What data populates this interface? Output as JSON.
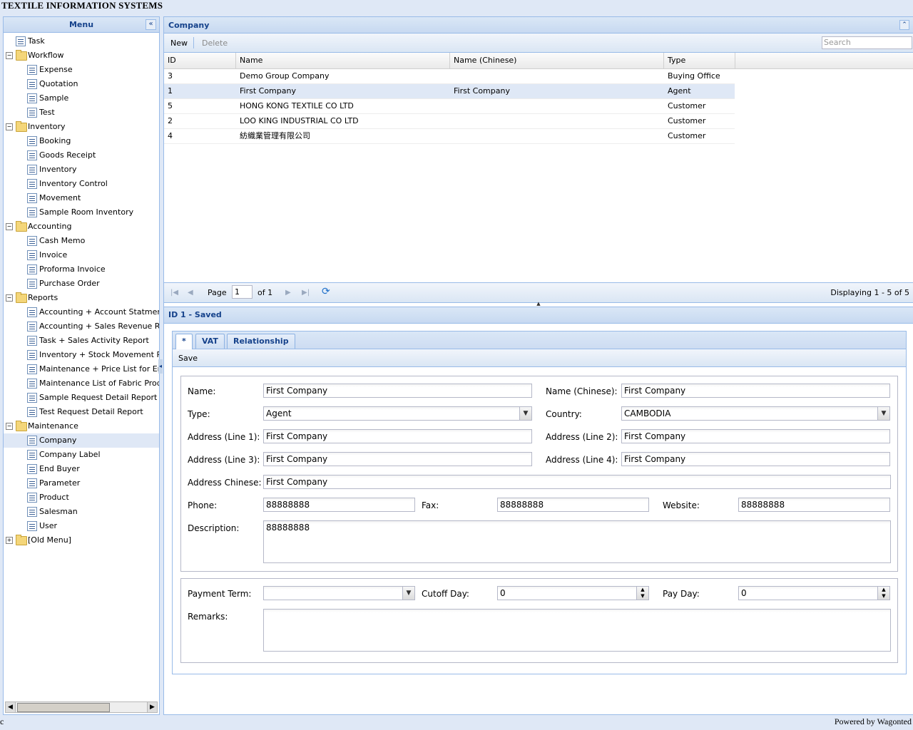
{
  "app": {
    "title": "TEXTILE INFORMATION SYSTEMS",
    "footer": "Powered by Wagonted",
    "footer_left": "c"
  },
  "sidebar": {
    "title": "Menu",
    "collapse_icon": "«",
    "items": [
      {
        "label": "Task",
        "level": 0,
        "type": "leaf"
      },
      {
        "label": "Workflow",
        "level": 0,
        "type": "folder",
        "expanded": true
      },
      {
        "label": "Expense",
        "level": 1,
        "type": "leaf"
      },
      {
        "label": "Quotation",
        "level": 1,
        "type": "leaf"
      },
      {
        "label": "Sample",
        "level": 1,
        "type": "leaf"
      },
      {
        "label": "Test",
        "level": 1,
        "type": "leaf"
      },
      {
        "label": "Inventory",
        "level": 0,
        "type": "folder",
        "expanded": true
      },
      {
        "label": "Booking",
        "level": 1,
        "type": "leaf"
      },
      {
        "label": "Goods Receipt",
        "level": 1,
        "type": "leaf"
      },
      {
        "label": "Inventory",
        "level": 1,
        "type": "leaf"
      },
      {
        "label": "Inventory Control",
        "level": 1,
        "type": "leaf"
      },
      {
        "label": "Movement",
        "level": 1,
        "type": "leaf"
      },
      {
        "label": "Sample Room Inventory",
        "level": 1,
        "type": "leaf"
      },
      {
        "label": "Accounting",
        "level": 0,
        "type": "folder",
        "expanded": true
      },
      {
        "label": "Cash Memo",
        "level": 1,
        "type": "leaf"
      },
      {
        "label": "Invoice",
        "level": 1,
        "type": "leaf"
      },
      {
        "label": "Proforma Invoice",
        "level": 1,
        "type": "leaf"
      },
      {
        "label": "Purchase Order",
        "level": 1,
        "type": "leaf"
      },
      {
        "label": "Reports",
        "level": 0,
        "type": "folder",
        "expanded": true
      },
      {
        "label": "Accounting + Account Statment",
        "level": 1,
        "type": "leaf"
      },
      {
        "label": "Accounting + Sales Revenue Report",
        "level": 1,
        "type": "leaf"
      },
      {
        "label": "Task + Sales Activity Report",
        "level": 1,
        "type": "leaf"
      },
      {
        "label": "Inventory + Stock Movement Report",
        "level": 1,
        "type": "leaf"
      },
      {
        "label": "Maintenance + Price List for End Buyer",
        "level": 1,
        "type": "leaf"
      },
      {
        "label": "Maintenance List of Fabric Products",
        "level": 1,
        "type": "leaf"
      },
      {
        "label": "Sample Request Detail Report",
        "level": 1,
        "type": "leaf"
      },
      {
        "label": "Test Request Detail Report",
        "level": 1,
        "type": "leaf"
      },
      {
        "label": "Maintenance",
        "level": 0,
        "type": "folder",
        "expanded": true
      },
      {
        "label": "Company",
        "level": 1,
        "type": "leaf",
        "selected": true
      },
      {
        "label": "Company Label",
        "level": 1,
        "type": "leaf"
      },
      {
        "label": "End Buyer",
        "level": 1,
        "type": "leaf"
      },
      {
        "label": "Parameter",
        "level": 1,
        "type": "leaf"
      },
      {
        "label": "Product",
        "level": 1,
        "type": "leaf"
      },
      {
        "label": "Salesman",
        "level": 1,
        "type": "leaf"
      },
      {
        "label": "User",
        "level": 1,
        "type": "leaf"
      },
      {
        "label": "[Old Menu]",
        "level": 0,
        "type": "folder",
        "expanded": false
      }
    ]
  },
  "main": {
    "title": "Company",
    "toolbar": {
      "new_label": "New",
      "delete_label": "Delete",
      "search_placeholder": "Search"
    },
    "grid": {
      "columns": [
        "ID",
        "Name",
        "Name (Chinese)",
        "Type"
      ],
      "rows": [
        [
          "3",
          "Demo Group Company",
          "",
          "Buying Office"
        ],
        [
          "1",
          "First Company",
          "First Company",
          "Agent"
        ],
        [
          "5",
          "HONG KONG TEXTILE CO LTD",
          "",
          "Customer"
        ],
        [
          "2",
          "LOO KING INDUSTRIAL CO LTD",
          "",
          "Customer"
        ],
        [
          "4",
          "紡織業管理有限公司",
          "",
          "Customer"
        ]
      ],
      "selected_index": 1
    },
    "pager": {
      "page_label": "Page",
      "page_value": "1",
      "of_label": "of 1",
      "display": "Displaying 1 - 5 of 5"
    }
  },
  "detail": {
    "title": "ID 1 - Saved",
    "tabs": [
      "*",
      "VAT",
      "Relationship"
    ],
    "active_tab": 0,
    "save_label": "Save",
    "labels": {
      "name": "Name:",
      "name_cn": "Name (Chinese):",
      "type": "Type:",
      "country": "Country:",
      "addr1": "Address (Line 1):",
      "addr2": "Address (Line 2):",
      "addr3": "Address (Line 3):",
      "addr4": "Address (Line 4):",
      "addr_cn": "Address Chinese:",
      "phone": "Phone:",
      "fax": "Fax:",
      "website": "Website:",
      "description": "Description:",
      "payment_term": "Payment Term:",
      "cutoff_day": "Cutoff Day:",
      "pay_day": "Pay Day:",
      "remarks": "Remarks:"
    },
    "values": {
      "name": "First Company",
      "name_cn": "First Company",
      "type": "Agent",
      "country": "CAMBODIA",
      "addr1": "First Company",
      "addr2": "First Company",
      "addr3": "First Company",
      "addr4": "First Company",
      "addr_cn": "First Company",
      "phone": "88888888",
      "fax": "88888888",
      "website": "88888888",
      "description": "88888888",
      "payment_term": "",
      "cutoff_day": "0",
      "pay_day": "0",
      "remarks": ""
    }
  }
}
